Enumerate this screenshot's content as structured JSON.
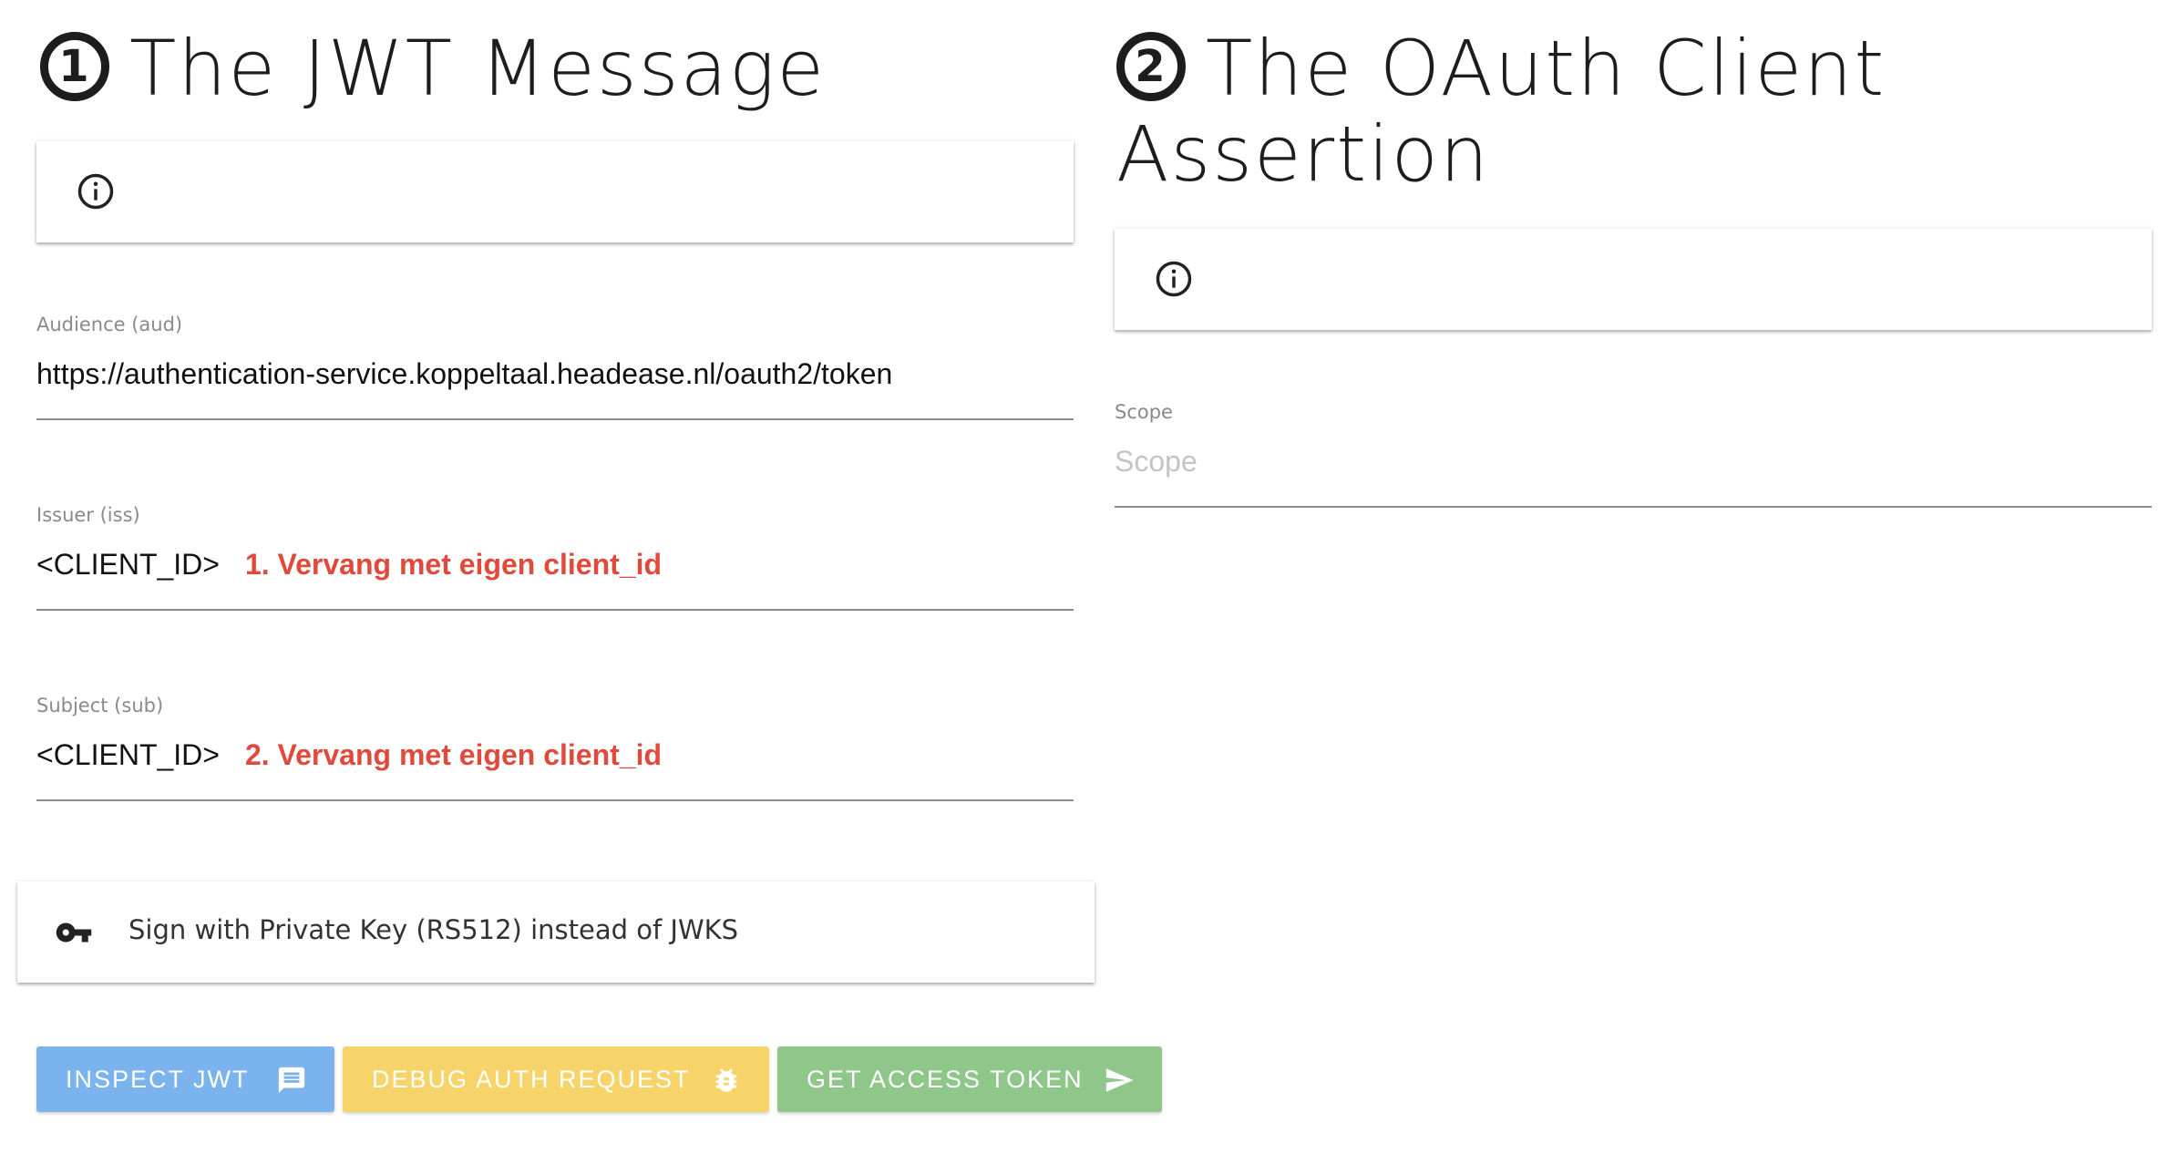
{
  "left": {
    "number": "1",
    "title": "The JWT Message",
    "info_icon": "info-circle-icon",
    "fields": [
      {
        "label": "Audience (aud)",
        "value": "https://authentication-service.koppeltaal.headease.nl/oauth2/token",
        "hint": ""
      },
      {
        "label": "Issuer (iss)",
        "value": "<CLIENT_ID>",
        "hint": "1. Vervang met eigen client_id"
      },
      {
        "label": "Subject (sub)",
        "value": "<CLIENT_ID>",
        "hint": "2. Vervang met eigen client_id"
      }
    ],
    "private_key": {
      "icon": "key-icon",
      "label": "Sign with Private Key (RS512) instead of JWKS"
    },
    "buttons": [
      {
        "label": "INSPECT JWT",
        "icon": "message-icon",
        "color": "#7ab3ee"
      },
      {
        "label": "DEBUG AUTH REQUEST",
        "icon": "bug-icon",
        "color": "#f7d46a"
      },
      {
        "label": "GET ACCESS TOKEN",
        "icon": "send-icon",
        "color": "#8fc68a"
      }
    ]
  },
  "right": {
    "number": "2",
    "title_line1": "The OAuth Client",
    "title_line2": "Assertion",
    "info_icon": "info-circle-icon",
    "scope": {
      "label": "Scope",
      "placeholder": "Scope",
      "value": ""
    }
  },
  "colors": {
    "hint": "#e04a3c",
    "underline": "#8c8c8c",
    "label": "#8a8a8a"
  }
}
